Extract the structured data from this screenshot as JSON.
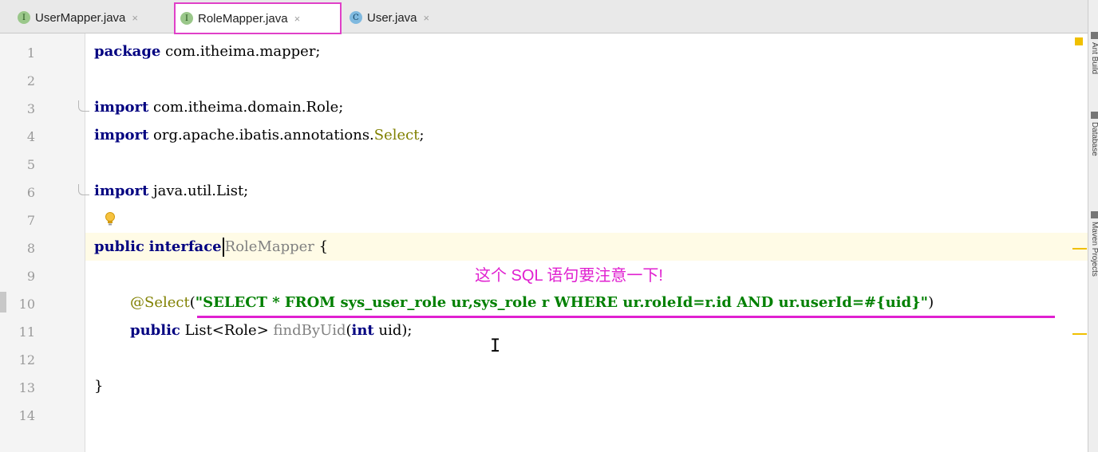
{
  "tabs": [
    {
      "label": "UserMapper.java",
      "icon": "interface-icon",
      "badge": "I",
      "close": "×",
      "active": false
    },
    {
      "label": "RoleMapper.java",
      "icon": "interface-icon",
      "badge": "I",
      "close": "×",
      "active": true
    },
    {
      "label": "User.java",
      "icon": "class-icon",
      "badge": "C",
      "close": "×",
      "active": false
    }
  ],
  "line_numbers": [
    "1",
    "2",
    "3",
    "4",
    "5",
    "6",
    "7",
    "8",
    "9",
    "10",
    "11",
    "12",
    "13",
    "14"
  ],
  "code": {
    "l1": {
      "kw": "package",
      "rest": " com.itheima.mapper;"
    },
    "l3": {
      "kw": "import",
      "rest": " com.itheima.domain.Role;"
    },
    "l4": {
      "kw": "import",
      "rest": " org.apache.ibatis.annotations.",
      "ann": "Select",
      "tail": ";"
    },
    "l6": {
      "kw": "import",
      "rest": " java.util.List;"
    },
    "l8": {
      "kw1": "public",
      "kw2": "interface",
      "name": "RoleMapper",
      "tail": " {"
    },
    "l10": {
      "ann": "@Select",
      "open": "(",
      "str": "\"SELECT * FROM sys_user_role ur,sys_role r WHERE ur.roleId=r.id AND ur.userId=#{uid}\"",
      "close": ")"
    },
    "l11": {
      "kw": "public",
      "type": " List<Role> ",
      "method": "findByUid",
      "open": "(",
      "kw2": "int",
      "tail": " uid);"
    },
    "l13": {
      "text": "}"
    }
  },
  "annotation_note": "这个 SQL 语句要注意一下!",
  "right_tools": [
    "Ant Build",
    "Database",
    "Maven Projects"
  ],
  "colors": {
    "keyword": "#000080",
    "string": "#008000",
    "annotation": "#808000",
    "highlight": "#e020d0"
  }
}
